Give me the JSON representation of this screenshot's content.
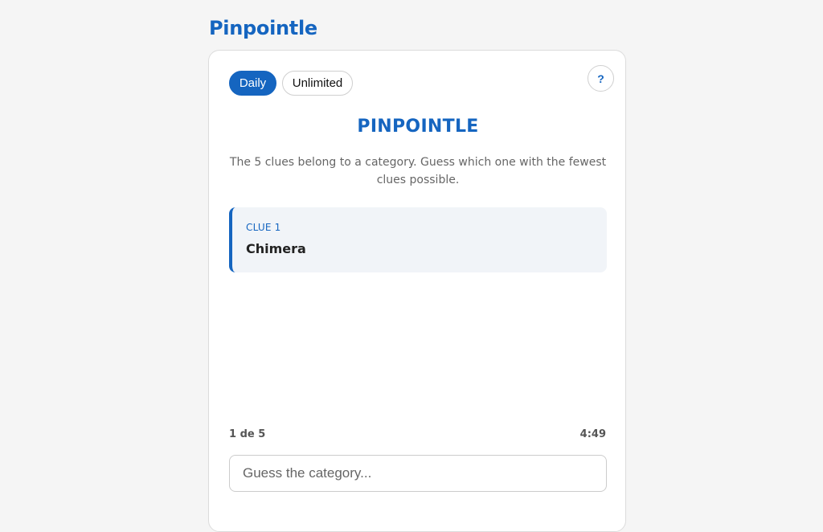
{
  "app": {
    "title": "Pinpointle"
  },
  "modes": {
    "daily_label": "Daily",
    "unlimited_label": "Unlimited",
    "selected": "Daily"
  },
  "help": {
    "label": "?"
  },
  "game": {
    "title": "PINPOINTLE",
    "instructions": "The 5 clues belong to a category. Guess which one with the fewest clues possible."
  },
  "clues": [
    {
      "label": "CLUE 1",
      "value": "Chimera"
    }
  ],
  "status": {
    "progress": "1 de 5",
    "timer": "4:49"
  },
  "guess": {
    "placeholder": "Guess the category...",
    "value": ""
  },
  "colors": {
    "accent": "#1565c0",
    "background": "#f5f5f5",
    "card": "#ffffff",
    "clue_background": "#f1f4f8"
  }
}
